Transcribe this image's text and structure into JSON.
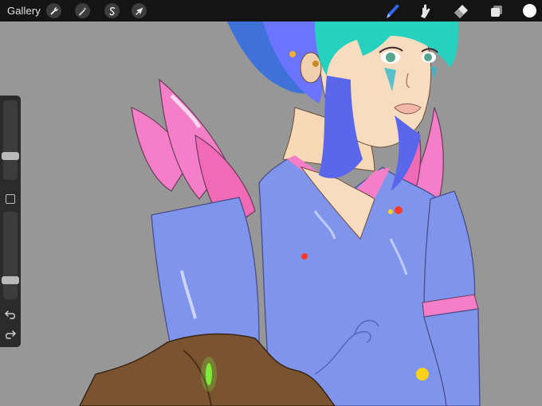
{
  "topbar": {
    "gallery_label": "Gallery",
    "left_tools": [
      "wrench-icon",
      "magic-wand-icon",
      "selection-icon",
      "transform-arrow-icon"
    ],
    "right_tools": [
      "brush-icon",
      "smudge-icon",
      "eraser-icon",
      "layers-icon"
    ],
    "active_tool": "brush-icon",
    "active_color": "#ffffff",
    "accent": "#2f6cf6"
  },
  "sidebar": {
    "brush_size_level": 0.72,
    "opacity_level": 0.81,
    "modify_button_icon": "square-icon",
    "undo_icon": "undo-icon",
    "redo_icon": "redo-icon"
  },
  "canvas": {
    "background": "#979797",
    "artwork": "character-illustration"
  }
}
